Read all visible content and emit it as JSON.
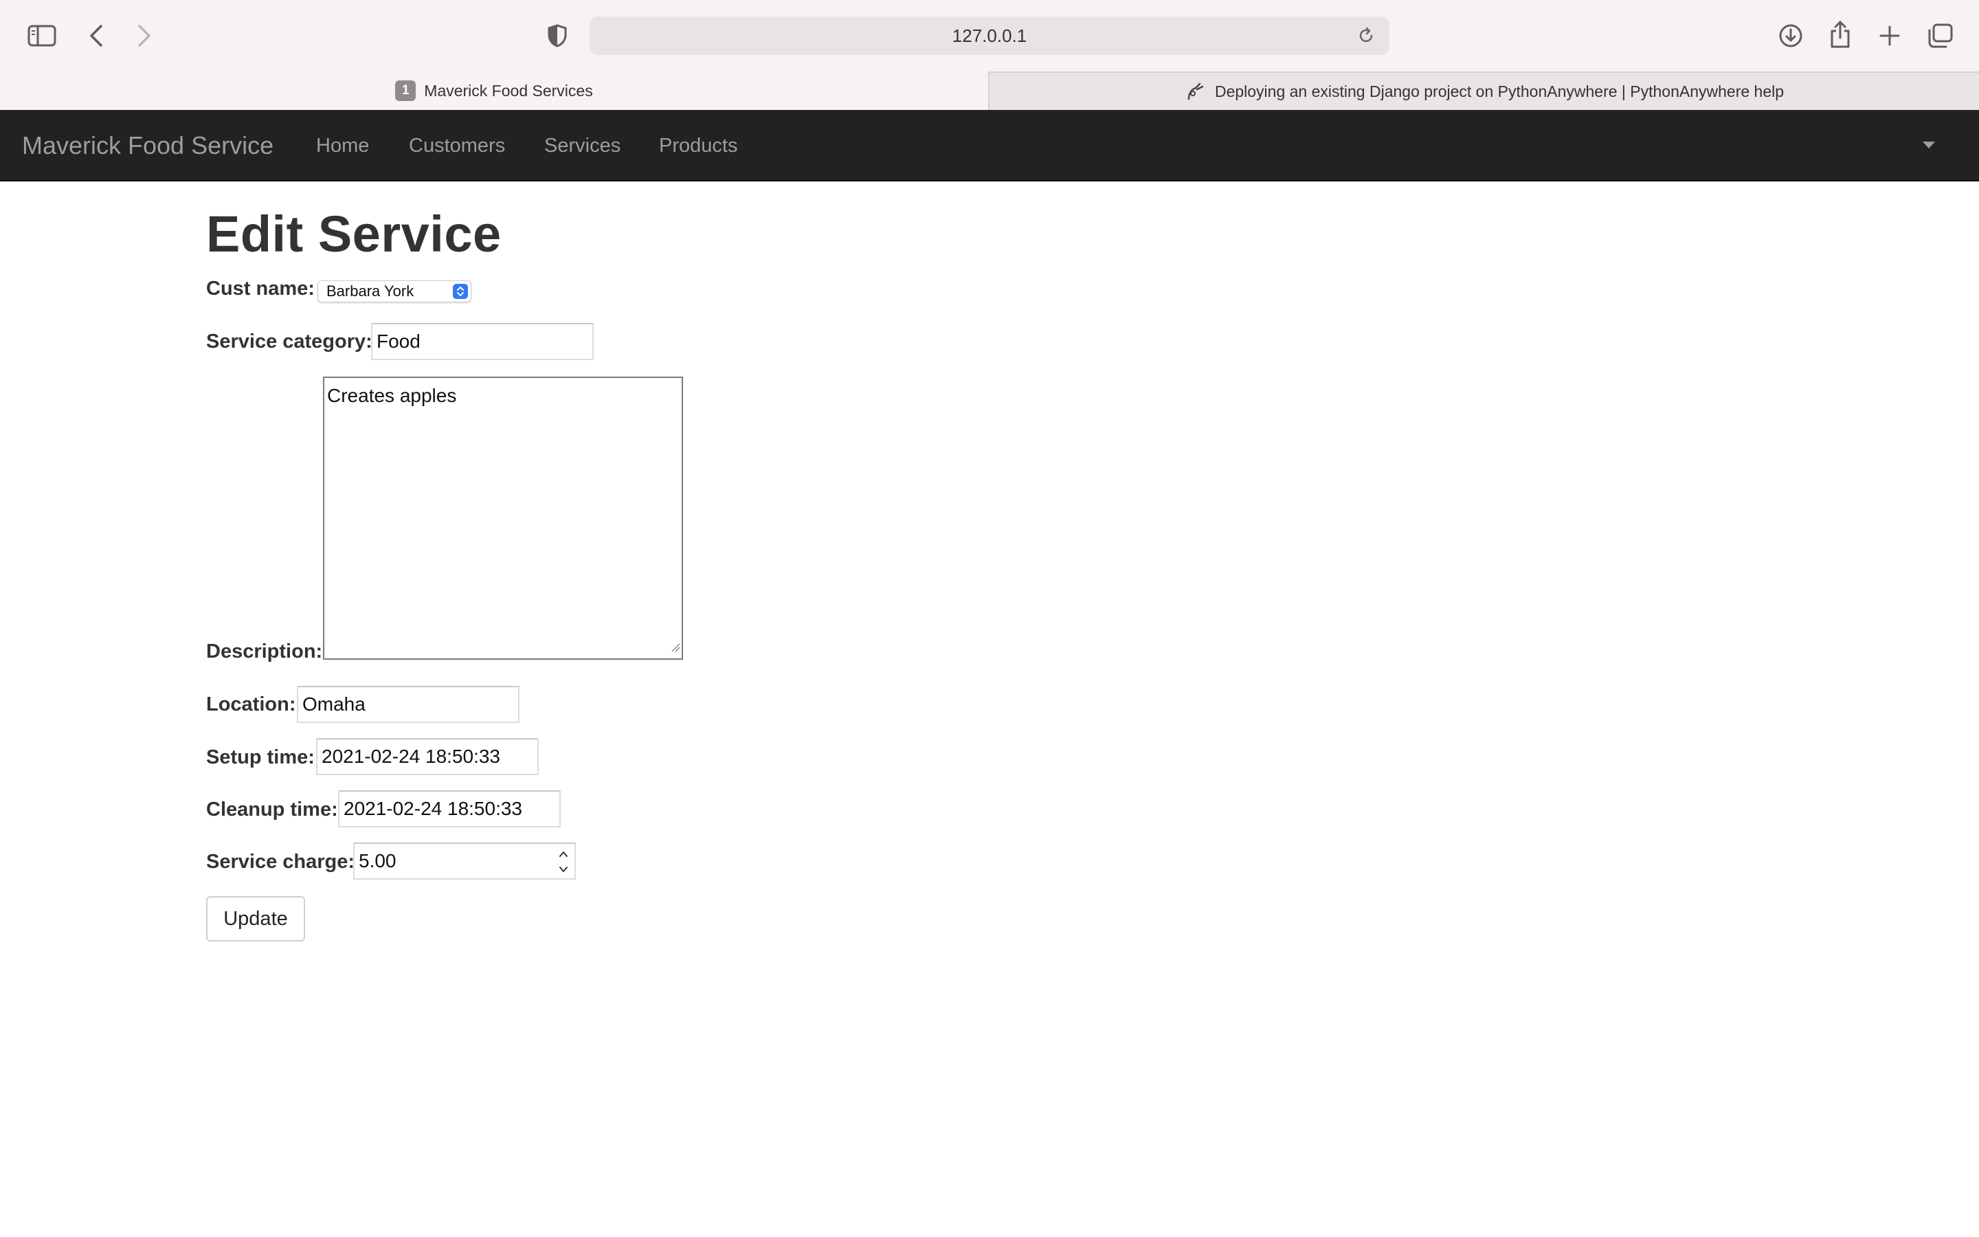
{
  "browser": {
    "url": "127.0.0.1",
    "tabs": [
      {
        "badge": "1",
        "title": "Maverick Food Services",
        "active": true
      },
      {
        "title": "Deploying an existing Django project on PythonAnywhere | PythonAnywhere help",
        "active": false
      }
    ],
    "icons": [
      "sidebar-icon",
      "back-icon",
      "forward-icon",
      "shield-icon",
      "reload-icon",
      "download-icon",
      "share-icon",
      "new-tab-icon",
      "tab-overview-icon"
    ]
  },
  "navbar": {
    "brand": "Maverick Food Service",
    "links": [
      "Home",
      "Customers",
      "Services",
      "Products"
    ],
    "colors": {
      "background": "#222222",
      "text": "#9d9d9d"
    }
  },
  "form": {
    "title": "Edit Service",
    "cust_name": {
      "label": "Cust name:",
      "value": "Barbara York"
    },
    "service_category": {
      "label": "Service category:",
      "value": "Food"
    },
    "description": {
      "label": "Description:",
      "value": "Creates apples"
    },
    "location": {
      "label": "Location:",
      "value": "Omaha"
    },
    "setup_time": {
      "label": "Setup time:",
      "value": "2021-02-24 18:50:33"
    },
    "cleanup_time": {
      "label": "Cleanup time:",
      "value": "2021-02-24 18:50:33"
    },
    "service_charge": {
      "label": "Service charge:",
      "value": "5.00"
    },
    "submit_label": "Update"
  }
}
